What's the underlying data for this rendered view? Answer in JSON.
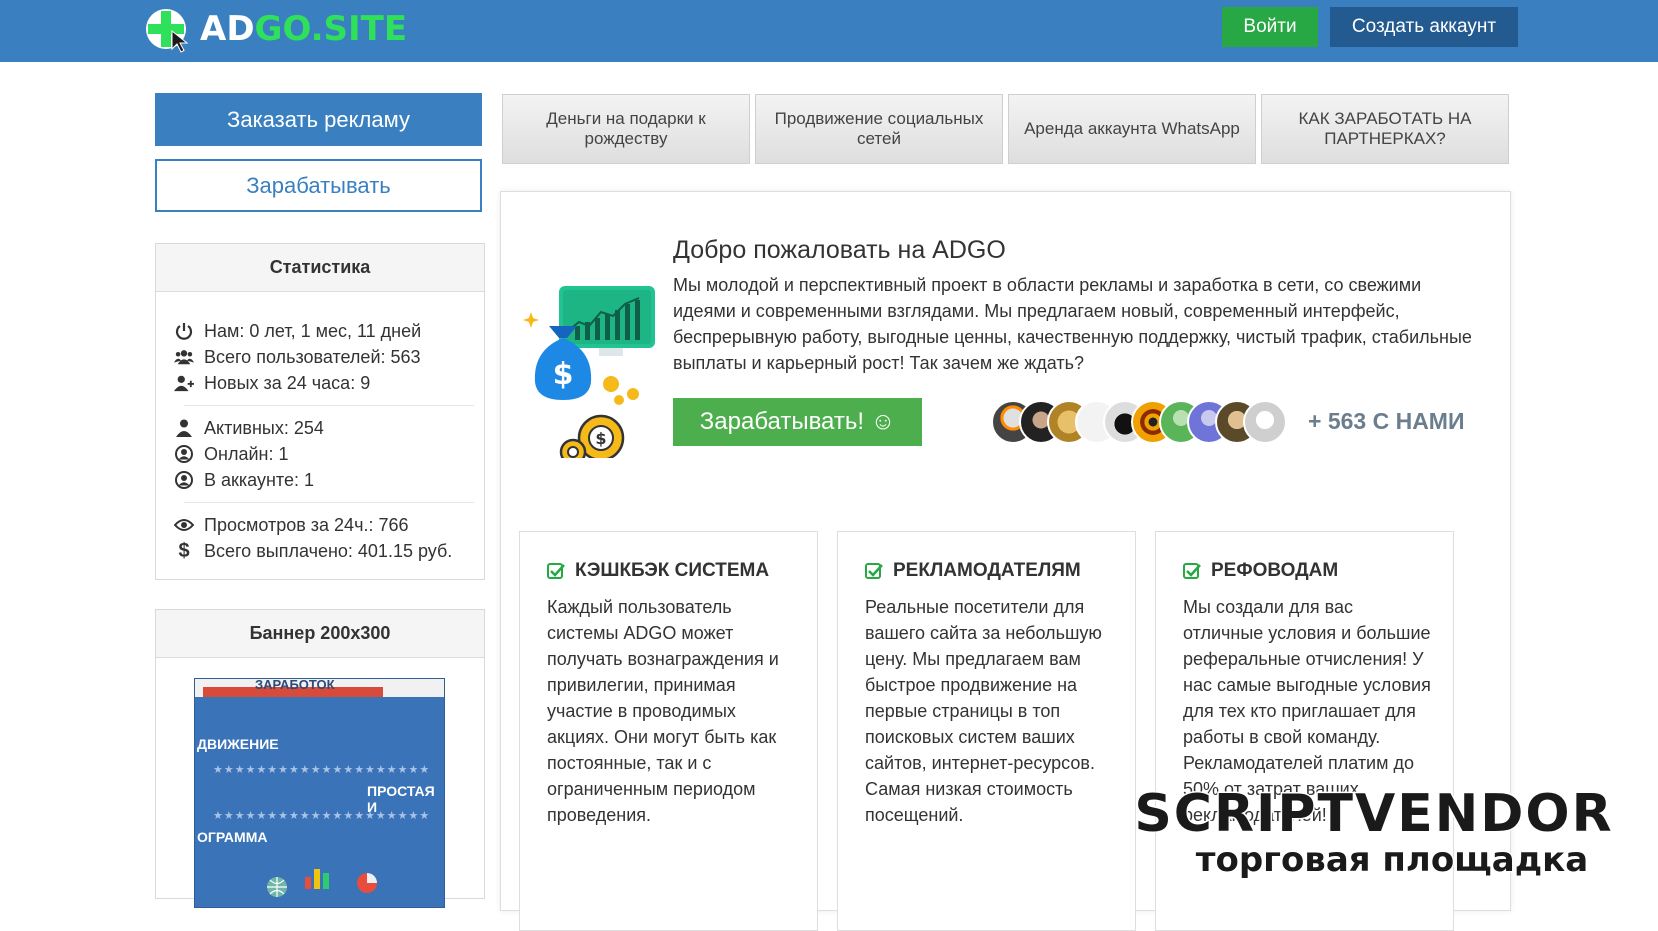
{
  "header": {
    "logo_ad": "AD",
    "logo_rest": "GO.SITE",
    "login_label": "Войти",
    "register_label": "Создать аккаунт"
  },
  "sidebar": {
    "order_ads_label": "Заказать рекламу",
    "earn_label": "Зарабатывать",
    "stats": {
      "title": "Статистика",
      "items": [
        {
          "icon": "power-icon",
          "text": "Нам: 0 лет, 1 мес, 11 дней"
        },
        {
          "icon": "users-icon",
          "text": "Всего пользователей: 563"
        },
        {
          "icon": "user-plus-icon",
          "text": "Новых за 24 часа: 9"
        },
        {
          "icon": "user-icon",
          "text": "Активных: 254"
        },
        {
          "icon": "user-circle-icon",
          "text": "Онлайн: 1"
        },
        {
          "icon": "user-circle-icon",
          "text": "В аккаунте: 1"
        },
        {
          "icon": "eye-icon",
          "text": "Просмотров за 24ч.: 766"
        },
        {
          "icon": "dollar-icon",
          "text": "Всего выплачено: 401.15 руб."
        }
      ]
    },
    "banner": {
      "title": "Баннер 200х300",
      "lines": [
        "ЗАРАБОТОК",
        "ДВИЖЕНИЕ",
        "ПРОСТАЯ И",
        "ОГРАММА"
      ]
    }
  },
  "tabs": [
    {
      "label": "Деньги на подарки к рождеству"
    },
    {
      "label": "Продвижение социальных сетей"
    },
    {
      "label": "Аренда аккаунта WhatsApp"
    },
    {
      "label": "КАК ЗАРАБОТАТЬ НА ПАРТНЕРКАХ?"
    }
  ],
  "hero": {
    "title": "Добро пожаловать на ADGO",
    "text": "Мы молодой и перспективный проект в области рекламы и заработка в сети, со свежими идеями и современными взглядами. Мы предлагаем новый, современный интерфейс, беспрерывную работу, выгодные ценны, качественную поддержку, чистый трафик, стабильные выплаты и карьерный рост! Так зачем же ждать?",
    "earn_button": "Зарабатывать! ☺",
    "with_us": "+ 563 С НАМИ"
  },
  "cards": [
    {
      "title": "КЭШКБЭК СИСТЕМА",
      "text": "Каждый пользователь системы ADGO может получать вознаграждения и привилегии, принимая участие в проводимых акциях. Они могут быть как постоянные, так и с ограниченным периодом проведения."
    },
    {
      "title": "РЕКЛАМОДАТЕЛЯМ",
      "text": "Реальные посетители для вашего сайта за небольшую цену. Мы предлагаем вам быстрое продвижение на первые страницы в топ поисковых систем ваших сайтов, интернет-ресурсов. Самая низкая стоимость посещений."
    },
    {
      "title": "РЕФОВОДАМ",
      "text": "Мы создали для вас отличные условия и большие реферальные отчисления! У нас самые выгодные условия для тех кто приглашает для работы в свой команду. Рекламодателей платим до 50% от затрат ваших рекламодателей!"
    }
  ],
  "watermark": {
    "title": "SCRIPTVENDOR",
    "subtitle": "торговая площадка"
  },
  "colors": {
    "header_blue": "#3a80c0",
    "logo_green": "#2fe05a",
    "login_green": "#27a844",
    "register_navy": "#235a8f",
    "earn_green": "#4cae4c"
  }
}
